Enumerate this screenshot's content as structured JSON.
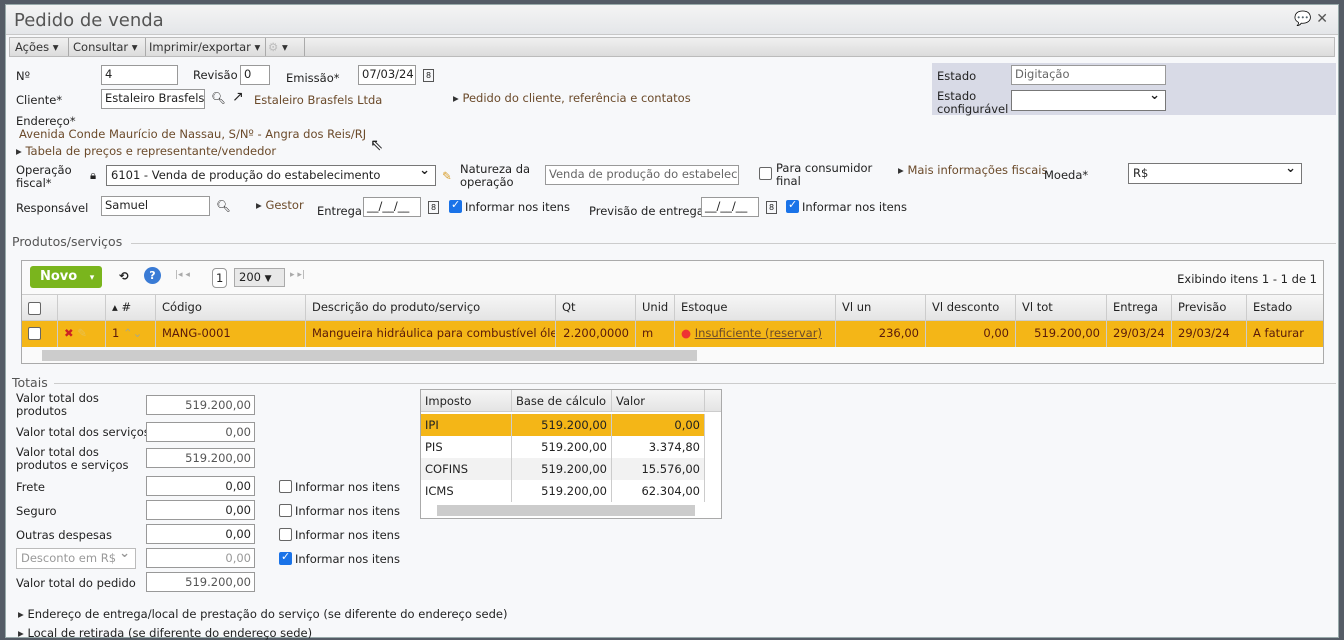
{
  "window": {
    "title": "Pedido de venda"
  },
  "menu": {
    "acoes": "Ações",
    "consultar": "Consultar",
    "imprimir": "Imprimir/exportar"
  },
  "form": {
    "numero_label": "Nº",
    "numero": "4",
    "revisao_label": "Revisão",
    "revisao": "0",
    "emissao_label": "Emissão*",
    "emissao": "07/03/24",
    "cliente_label": "Cliente*",
    "cliente": "Estaleiro Brasfels L",
    "cliente_link": "Estaleiro Brasfels Ltda",
    "pedido_cliente": "Pedido do cliente, referência e contatos",
    "endereco_label": "Endereço*",
    "endereco": "Avenida Conde Maurício de Nassau, S/Nº - Angra dos Reis/RJ",
    "tabela_precos": "Tabela de preços e representante/vendedor",
    "operacao_label_1": "Operação",
    "operacao_label_2": "fiscal*",
    "operacao": "6101 - Venda de produção do estabelecimento",
    "natureza_label_1": "Natureza da",
    "natureza_label_2": "operação",
    "natureza": "Venda de produção do estabelecimento",
    "consumidor_label_1": "Para consumidor",
    "consumidor_label_2": "final",
    "mais_info": "Mais informações fiscais",
    "moeda_label": "Moeda*",
    "moeda": "R$",
    "responsavel_label": "Responsável",
    "responsavel": "Samuel",
    "gestor": "Gestor",
    "entrega_label": "Entrega",
    "entrega": "__/__/__",
    "informar_itens": "Informar nos itens",
    "previsao_label": "Previsão de entrega",
    "previsao": "__/__/__",
    "estado_label": "Estado",
    "estado": "Digitação",
    "estado_conf_label_1": "Estado",
    "estado_conf_label_2": "configurável",
    "estado_conf": ""
  },
  "products": {
    "section": "Produtos/serviços",
    "novo": "Novo",
    "page": "1",
    "page_size": "200",
    "showing": "Exibindo itens 1 - 1 de 1",
    "columns": [
      "#",
      "Código",
      "Descrição do produto/serviço",
      "Qt",
      "Unid",
      "Estoque",
      "Vl un",
      "Vl desconto",
      "Vl tot",
      "Entrega",
      "Previsão",
      "Estado"
    ],
    "rows": [
      {
        "num": "1",
        "codigo": "MANG-0001",
        "descricao": "Mangueira hidráulica para combustível óle...",
        "qt": "2.200,0000",
        "unid": "m",
        "estoque": "Insuficiente (reservar)",
        "vl_un": "236,00",
        "vl_desconto": "0,00",
        "vl_tot": "519.200,00",
        "entrega": "29/03/24",
        "previsao": "29/03/24",
        "estado": "A faturar"
      }
    ]
  },
  "totais": {
    "section": "Totais",
    "produtos_1": "Valor total dos",
    "produtos_2": "produtos",
    "produtos": "519.200,00",
    "servicos_label": "Valor total dos serviços",
    "servicos": "0,00",
    "ps_1": "Valor total dos",
    "ps_2": "produtos e serviços",
    "ps": "519.200,00",
    "frete_label": "Frete",
    "frete": "0,00",
    "seguro_label": "Seguro",
    "seguro": "0,00",
    "outras_label": "Outras despesas",
    "outras": "0,00",
    "desconto_label": "Desconto em R$",
    "desconto": "0,00",
    "pedido_label": "Valor total do pedido",
    "pedido": "519.200,00",
    "informar_itens": "Informar nos itens"
  },
  "impostos": {
    "columns": [
      "Imposto",
      "Base de cálculo",
      "Valor"
    ],
    "rows": [
      [
        "IPI",
        "519.200,00",
        "0,00"
      ],
      [
        "PIS",
        "519.200,00",
        "3.374,80"
      ],
      [
        "COFINS",
        "519.200,00",
        "15.576,00"
      ],
      [
        "ICMS",
        "519.200,00",
        "62.304,00"
      ]
    ]
  },
  "footer": {
    "endereco_entrega": "Endereço de entrega/local de prestação do serviço (se diferente do endereço sede)",
    "local_retirada": "Local de retirada (se diferente do endereço sede)"
  }
}
